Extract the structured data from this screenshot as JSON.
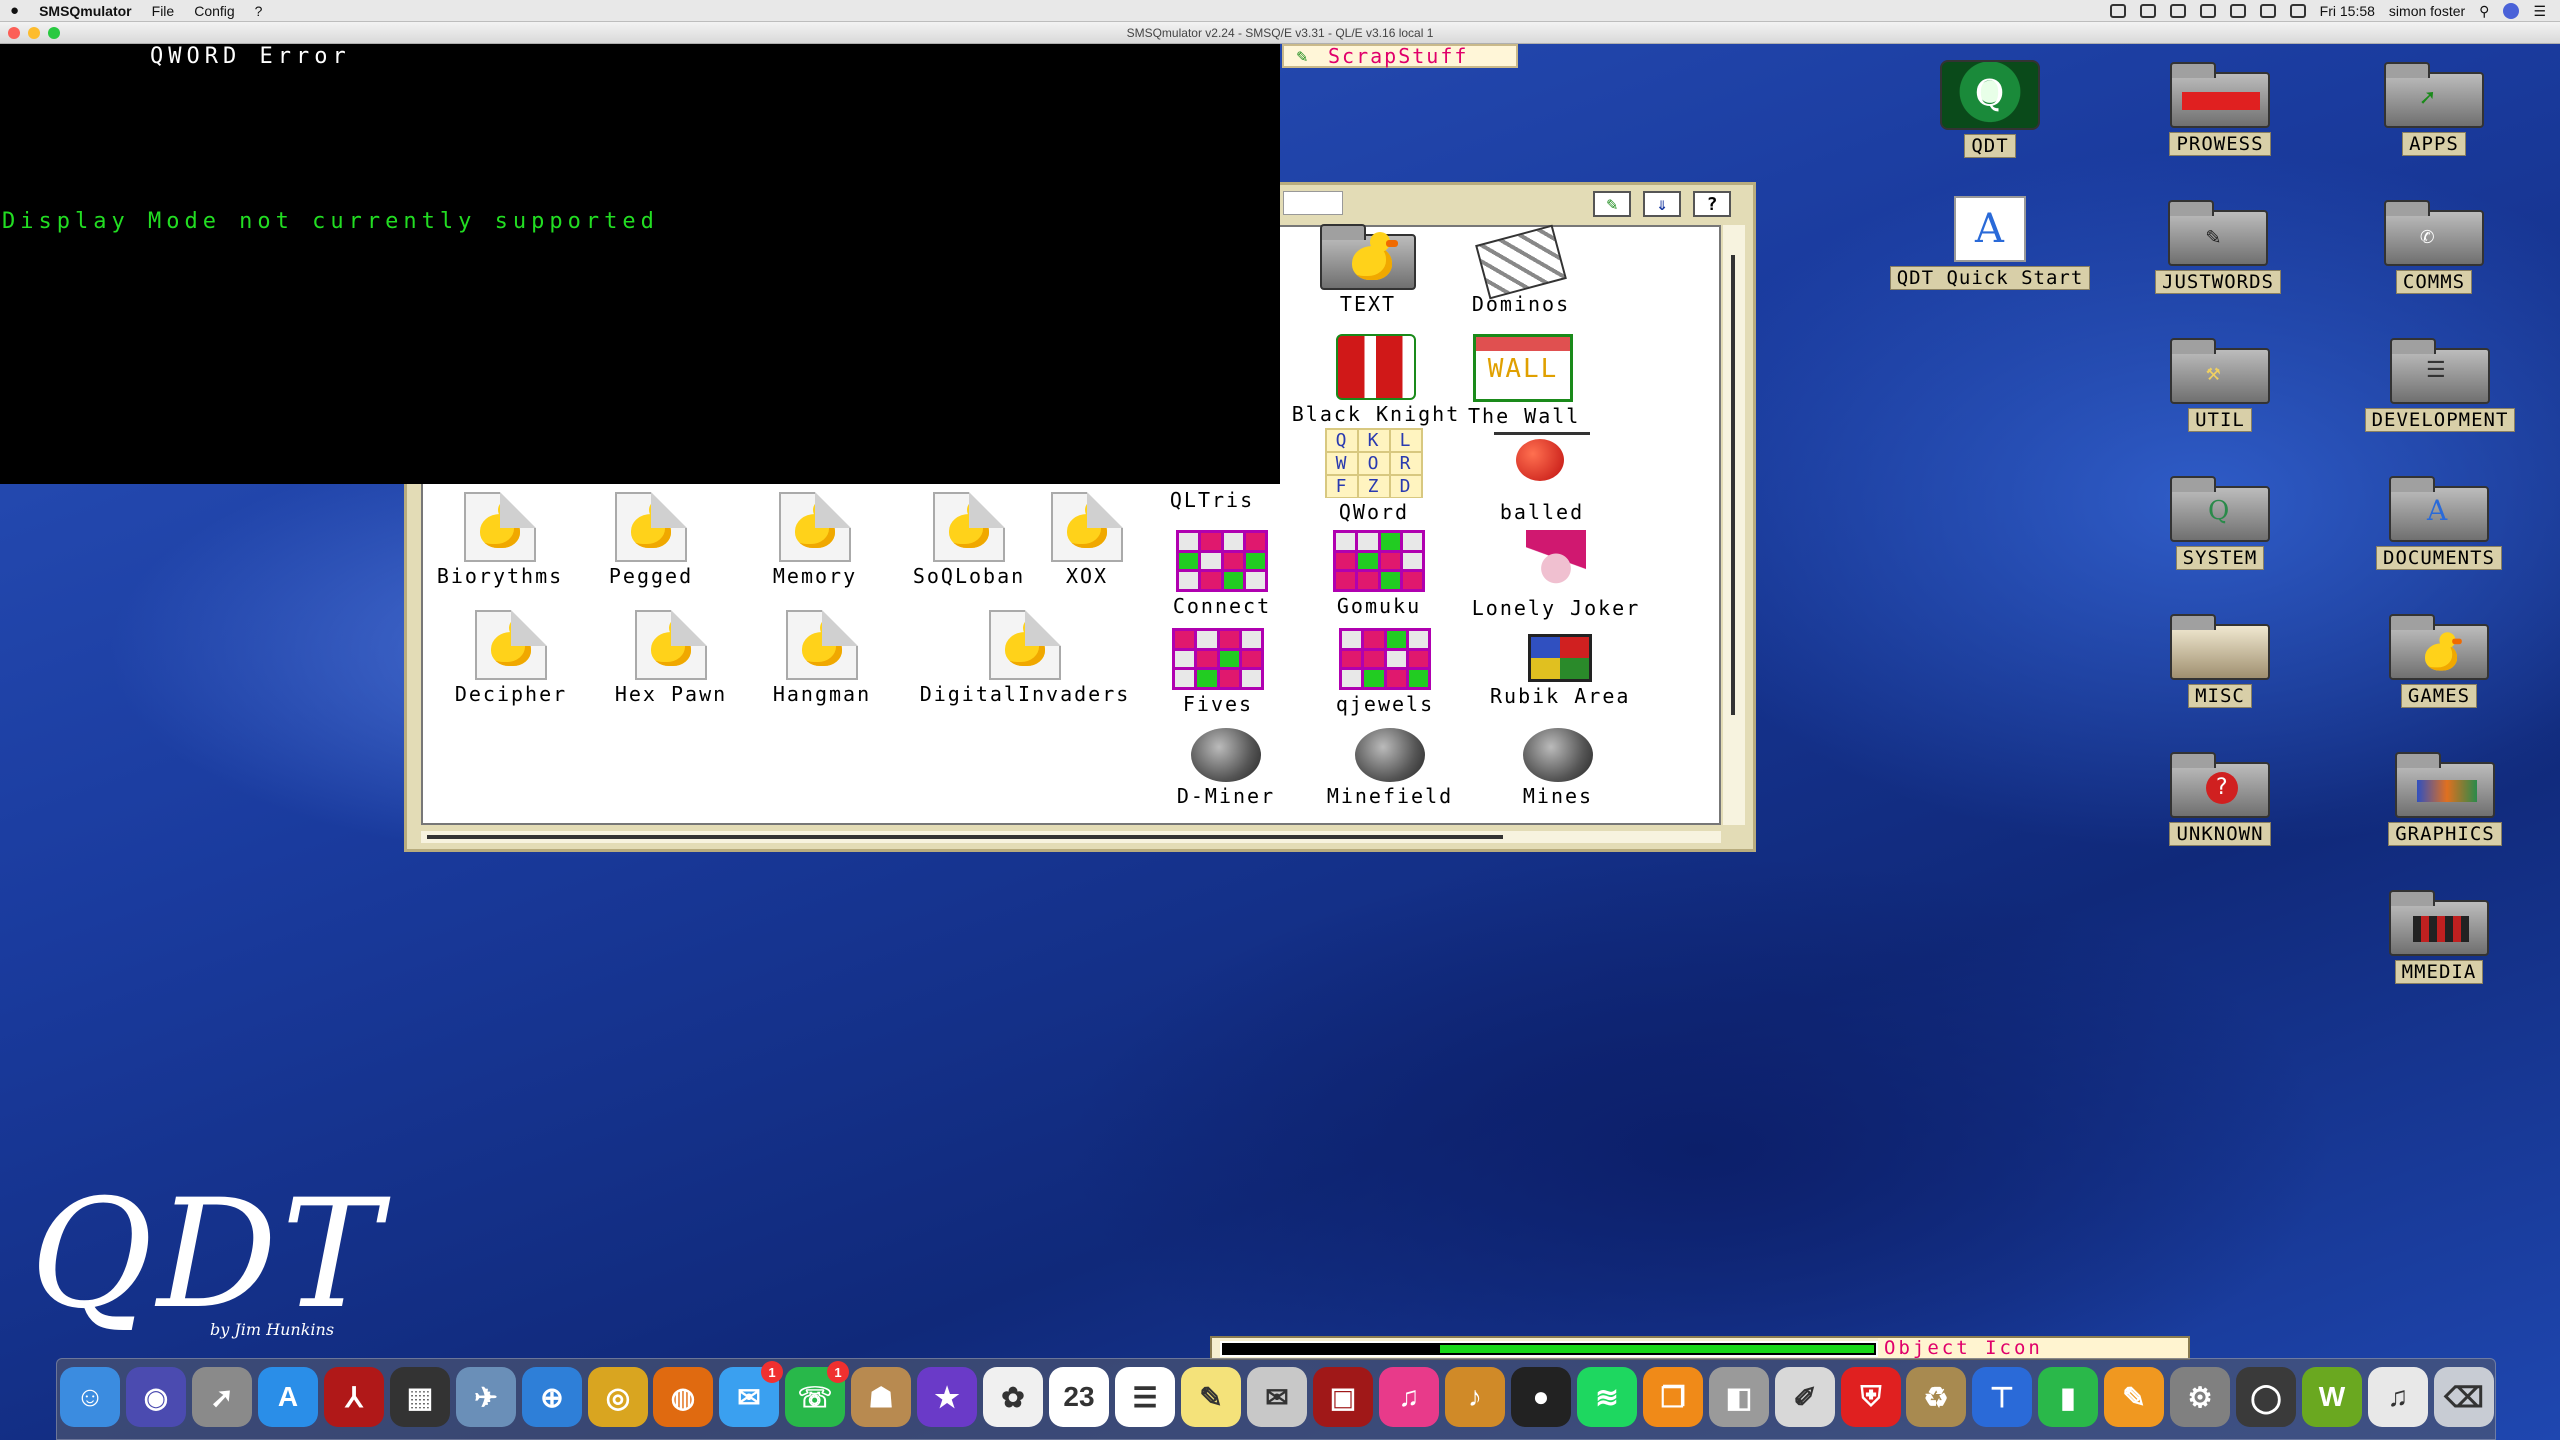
{
  "menubar": {
    "app_name": "SMSQmulator",
    "menus": [
      "File",
      "Config",
      "?"
    ],
    "clock": "Fri 15:58",
    "user": "simon foster"
  },
  "window": {
    "title": "SMSQmulator v2.24 - SMSQ/E v3.31 - QL/E v3.16 local 1"
  },
  "console": {
    "error_title": "QWORD Error",
    "message": "Display Mode not currently supported"
  },
  "scrap_tab": {
    "label": "ScrapStuff"
  },
  "games_window": {
    "icons": [
      "TEXT",
      "Dominos",
      "Black Knight",
      "The Wall",
      "QLTris",
      "QWord",
      "balled",
      "Biorythms",
      "Pegged",
      "Memory",
      "SoQLoban",
      "XOX",
      "Connect",
      "Gomuku",
      "Lonely Joker",
      "Decipher",
      "Hex Pawn",
      "Hangman",
      "DigitalInvaders",
      "Fives",
      "qjewels",
      "Rubik Area",
      "D-Miner",
      "Minefield",
      "Mines"
    ],
    "buttons": {
      "move": "✎",
      "down": "⇓",
      "help": "?"
    }
  },
  "desktop_icons": [
    "QDT",
    "PROWESS",
    "APPS",
    "QDT Quick Start",
    "JUSTWORDS",
    "COMMS",
    "UTIL",
    "DEVELOPMENT",
    "SYSTEM",
    "DOCUMENTS",
    "MISC",
    "GAMES",
    "UNKNOWN",
    "GRAPHICS",
    "MMEDIA"
  ],
  "status_bar": {
    "text": "Object Icon"
  },
  "logo": {
    "text": "QDT",
    "byline": "by Jim Hunkins"
  },
  "dock": {
    "items": [
      {
        "name": "finder",
        "color": "#3b8ce0",
        "glyph": "☺"
      },
      {
        "name": "siri",
        "color": "#4b4bb0",
        "glyph": "◉"
      },
      {
        "name": "launchpad",
        "color": "#8a8a8a",
        "glyph": "➚"
      },
      {
        "name": "app-store",
        "color": "#2a8ee8",
        "glyph": "A"
      },
      {
        "name": "acrobat",
        "color": "#b01818",
        "glyph": "⅄"
      },
      {
        "name": "photo-booth",
        "color": "#333333",
        "glyph": "▦"
      },
      {
        "name": "preview",
        "color": "#6a8fb8",
        "glyph": "✈"
      },
      {
        "name": "safari",
        "color": "#2e7fd8",
        "glyph": "⊕"
      },
      {
        "name": "chrome",
        "color": "#d9a520",
        "glyph": "◎"
      },
      {
        "name": "firefox",
        "color": "#e06a10",
        "glyph": "◍"
      },
      {
        "name": "messages",
        "color": "#3aa0f0",
        "glyph": "✉",
        "badge": "1"
      },
      {
        "name": "facetime",
        "color": "#28b84a",
        "glyph": "☏",
        "badge": "1"
      },
      {
        "name": "contacts",
        "color": "#b88a50",
        "glyph": "☗"
      },
      {
        "name": "imovie",
        "color": "#6a3ac8",
        "glyph": "★"
      },
      {
        "name": "photos",
        "color": "#f0f0f0",
        "glyph": "✿"
      },
      {
        "name": "calendar",
        "color": "#ffffff",
        "glyph": "23"
      },
      {
        "name": "reminders",
        "color": "#ffffff",
        "glyph": "☰"
      },
      {
        "name": "notes",
        "color": "#f4e27a",
        "glyph": "✎"
      },
      {
        "name": "mail",
        "color": "#c8c8c8",
        "glyph": "✉"
      },
      {
        "name": "photo-app",
        "color": "#a01818",
        "glyph": "▣"
      },
      {
        "name": "itunes",
        "color": "#e83a8a",
        "glyph": "♫"
      },
      {
        "name": "garageband",
        "color": "#d08a28",
        "glyph": "♪"
      },
      {
        "name": "vinyl",
        "color": "#222222",
        "glyph": "●"
      },
      {
        "name": "spotify",
        "color": "#1ed760",
        "glyph": "≋"
      },
      {
        "name": "ibooks",
        "color": "#f08a18",
        "glyph": "❐"
      },
      {
        "name": "disk-utility",
        "color": "#9a9a9a",
        "glyph": "◧"
      },
      {
        "name": "script-editor",
        "color": "#d8d8d8",
        "glyph": "✐"
      },
      {
        "name": "shield-app",
        "color": "#e02020",
        "glyph": "⛨"
      },
      {
        "name": "archive-utility",
        "color": "#a88a50",
        "glyph": "♻"
      },
      {
        "name": "keynote",
        "color": "#2a6ad8",
        "glyph": "⊤"
      },
      {
        "name": "numbers",
        "color": "#2ab84a",
        "glyph": "▮"
      },
      {
        "name": "pages",
        "color": "#f09820",
        "glyph": "✎"
      },
      {
        "name": "system-preferences",
        "color": "#808080",
        "glyph": "⚙"
      },
      {
        "name": "smsqmulator",
        "color": "#3a3a3a",
        "glyph": "◯"
      },
      {
        "name": "wolfsoft",
        "color": "#6aa820",
        "glyph": "W"
      },
      {
        "name": "music-file",
        "color": "#e8e8e8",
        "glyph": "♫"
      },
      {
        "name": "trash",
        "color": "#c8ccd4",
        "glyph": "⌫"
      }
    ]
  }
}
